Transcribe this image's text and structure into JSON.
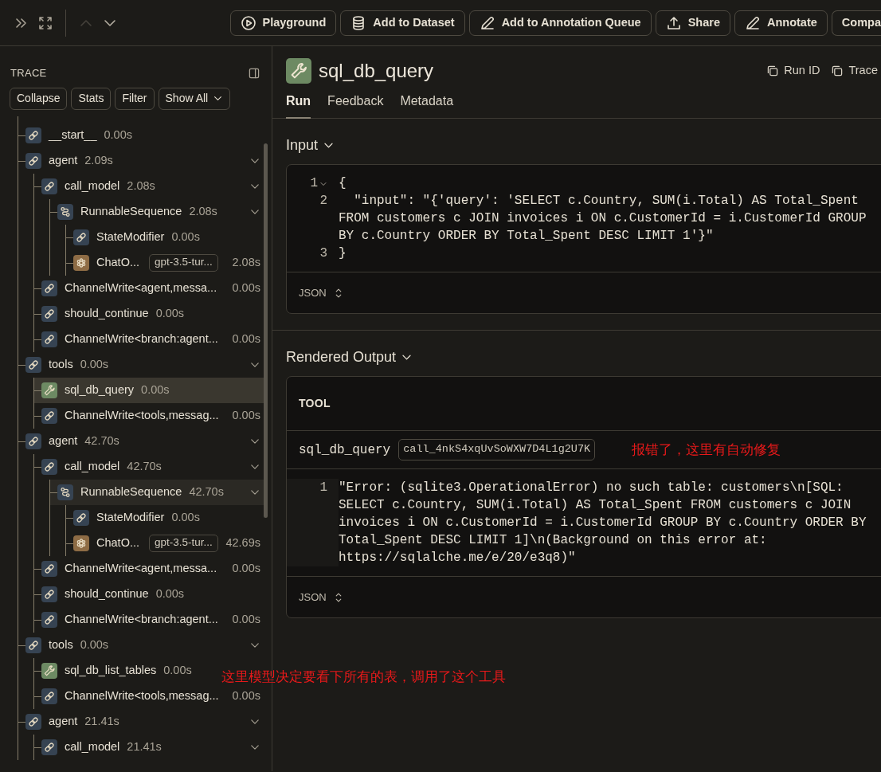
{
  "toolbar": {
    "previous": {
      "disabled": true
    },
    "next": {
      "disabled": false
    },
    "buttons": [
      {
        "label": "Playground"
      },
      {
        "label": "Add to Dataset"
      },
      {
        "label": "Add to Annotation Queue"
      },
      {
        "label": "Share"
      },
      {
        "label": "Annotate"
      },
      {
        "label": "Compa"
      }
    ]
  },
  "trace_panel": {
    "title": "TRACE",
    "filters": [
      "Collapse",
      "Stats",
      "Filter"
    ],
    "view_select": "Show All",
    "tree": [
      {
        "name": "__start__",
        "duration": "0.00s",
        "kind": "chain",
        "selected": false,
        "hovered": false
      },
      {
        "name": "agent",
        "duration": "2.09s",
        "kind": "chain",
        "selected": false,
        "hovered": false,
        "expanded": true,
        "children": [
          {
            "name": "call_model",
            "duration": "2.08s",
            "kind": "chain",
            "selected": false,
            "hovered": false,
            "expanded": true,
            "children": [
              {
                "name": "RunnableSequence",
                "duration": "2.08s",
                "kind": "sequence",
                "selected": false,
                "hovered": false,
                "expanded": true,
                "children": [
                  {
                    "name": "StateModifier",
                    "duration": "0.00s",
                    "kind": "chain",
                    "selected": false,
                    "hovered": false
                  },
                  {
                    "name": "ChatO...",
                    "model": "gpt-3.5-tur...",
                    "duration": "2.08s",
                    "kind": "llm",
                    "selected": false,
                    "hovered": false
                  }
                ]
              }
            ]
          },
          {
            "name": "ChannelWrite<agent,messa...",
            "duration": "0.00s",
            "kind": "chain",
            "selected": false,
            "hovered": false
          },
          {
            "name": "should_continue",
            "duration": "0.00s",
            "kind": "chain",
            "selected": false,
            "hovered": false
          },
          {
            "name": "ChannelWrite<branch:agent...",
            "duration": "0.00s",
            "kind": "chain",
            "selected": false,
            "hovered": false
          }
        ]
      },
      {
        "name": "tools",
        "duration": "0.00s",
        "kind": "chain",
        "selected": false,
        "hovered": false,
        "expanded": true,
        "children": [
          {
            "name": "sql_db_query",
            "duration": "0.00s",
            "kind": "tool",
            "selected": true,
            "hovered": false
          },
          {
            "name": "ChannelWrite<tools,messag...",
            "duration": "0.00s",
            "kind": "chain",
            "selected": false,
            "hovered": false
          }
        ]
      },
      {
        "name": "agent",
        "duration": "42.70s",
        "kind": "chain",
        "selected": false,
        "hovered": false,
        "expanded": true,
        "children": [
          {
            "name": "call_model",
            "duration": "42.70s",
            "kind": "chain",
            "selected": false,
            "hovered": false,
            "expanded": true,
            "children": [
              {
                "name": "RunnableSequence",
                "duration": "42.70s",
                "kind": "sequence",
                "selected": false,
                "hovered": true,
                "expanded": true,
                "children": [
                  {
                    "name": "StateModifier",
                    "duration": "0.00s",
                    "kind": "chain",
                    "selected": false,
                    "hovered": false
                  },
                  {
                    "name": "ChatO...",
                    "model": "gpt-3.5-tur...",
                    "duration": "42.69s",
                    "kind": "llm",
                    "selected": false,
                    "hovered": false
                  }
                ]
              }
            ]
          },
          {
            "name": "ChannelWrite<agent,messa...",
            "duration": "0.00s",
            "kind": "chain",
            "selected": false,
            "hovered": false
          },
          {
            "name": "should_continue",
            "duration": "0.00s",
            "kind": "chain",
            "selected": false,
            "hovered": false
          },
          {
            "name": "ChannelWrite<branch:agent...",
            "duration": "0.00s",
            "kind": "chain",
            "selected": false,
            "hovered": false
          }
        ]
      },
      {
        "name": "tools",
        "duration": "0.00s",
        "kind": "chain",
        "selected": false,
        "hovered": false,
        "expanded": true,
        "children": [
          {
            "name": "sql_db_list_tables",
            "duration": "0.00s",
            "kind": "tool",
            "selected": false,
            "hovered": false
          },
          {
            "name": "ChannelWrite<tools,messag...",
            "duration": "0.00s",
            "kind": "chain",
            "selected": false,
            "hovered": false
          }
        ]
      },
      {
        "name": "agent",
        "duration": "21.41s",
        "kind": "chain",
        "selected": false,
        "hovered": false,
        "expanded": true,
        "children": [
          {
            "name": "call_model",
            "duration": "21.41s",
            "kind": "chain",
            "selected": false,
            "hovered": false,
            "expanded": true
          }
        ]
      }
    ]
  },
  "run": {
    "title": "sql_db_query",
    "header_actions": [
      "Run ID",
      "Trace"
    ],
    "tabs": [
      {
        "label": "Run",
        "selected": true
      },
      {
        "label": "Feedback",
        "selected": false
      },
      {
        "label": "Metadata",
        "selected": false
      }
    ],
    "input": {
      "heading": "Input",
      "expanded": true,
      "format": "JSON",
      "lines": [
        {
          "number": "1",
          "text": "{",
          "foldable": true
        },
        {
          "number": "2",
          "text": "  \"input\": \"{'query': 'SELECT c.Country, SUM(i.Total) AS Total_Spent FROM customers c JOIN invoices i ON c.CustomerId = i.CustomerId GROUP BY c.Country ORDER BY Total_Spent DESC LIMIT 1'}\"",
          "foldable": false
        },
        {
          "number": "3",
          "text": "}",
          "foldable": false
        }
      ]
    },
    "output": {
      "heading": "Rendered Output",
      "expanded": true,
      "role": "TOOL",
      "tool_name": "sql_db_query",
      "call_id": "call_4nkS4xqUvSoWXW7D4L1g2U7K",
      "format": "JSON",
      "lines": [
        {
          "number": "1",
          "text": "\"Error: (sqlite3.OperationalError) no such table: customers\\n[SQL: SELECT c.Country, SUM(i.Total) AS Total_Spent FROM customers c JOIN invoices i ON c.CustomerId = i.CustomerId GROUP BY c.Country ORDER BY Total_Spent DESC LIMIT 1]\\n(Background on this error at: https://sqlalche.me/e/20/e3q8)\"",
          "foldable": false
        }
      ]
    }
  },
  "annotations": [
    {
      "text": "报错了，这里有自动修复"
    },
    {
      "text": "这里模型决定要看下所有的表，调用了这个工具"
    }
  ]
}
